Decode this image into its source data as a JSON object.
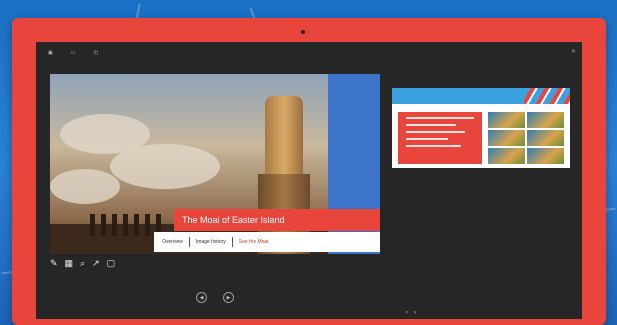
{
  "topbar": {
    "items": [
      {
        "label": "",
        "icon": "slideshow-icon"
      },
      {
        "label": "",
        "icon": "presenter-icon"
      },
      {
        "label": "",
        "icon": "monitor-icon"
      }
    ],
    "close_icon": "close-icon"
  },
  "subbar": {
    "label": ""
  },
  "right_tabs": [
    "",
    ""
  ],
  "slide": {
    "title": "The Moai of Easter Island",
    "nav": [
      "Overview",
      "Image history",
      "See the Moai"
    ]
  },
  "tools": [
    "pen-icon",
    "grid-icon",
    "magnifier-icon",
    "pointer-icon",
    "subtitle-icon"
  ],
  "playback": {
    "label": ""
  },
  "page_indicator": [
    "‹",
    "›"
  ],
  "side_thumb": {
    "title": ""
  },
  "notes": {
    "label": "",
    "text": ""
  },
  "colors": {
    "accent": "#e8453c",
    "screen": "#262626",
    "blue": "#3aa2e0",
    "bezel": "#e8453c"
  }
}
